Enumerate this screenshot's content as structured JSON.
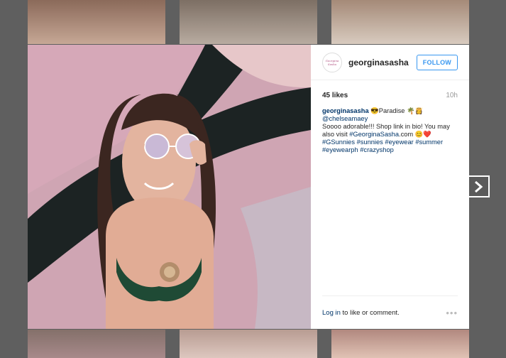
{
  "post": {
    "username": "georginasasha",
    "avatar_text": "Georgina Sasha",
    "follow_label": "FOLLOW",
    "likes": "45 likes",
    "time": "10h",
    "caption_user": "georginasasha",
    "caption_line1": " 😎Paradise 🌴👸",
    "mention": "@chelseamaey",
    "caption_text1": "Soooo adorable!!! Shop link in bio! You may also visit ",
    "caption_hashtag_main": "#GeorginaSasha",
    "caption_text2": ".com 😊❤️",
    "hashtags": [
      "#GSunnies",
      "#sunnies",
      "#eyewear",
      "#summer",
      "#eyewearph",
      "#crazyshop"
    ],
    "login_link": "Log in",
    "login_rest": " to like or comment.",
    "more_icon": "•••"
  },
  "colors": {
    "accent": "#3897f0",
    "link": "#003569",
    "overlay": "#5f5f5f"
  },
  "icons": {
    "next": "chevron-right-icon",
    "more": "more-options-icon"
  }
}
